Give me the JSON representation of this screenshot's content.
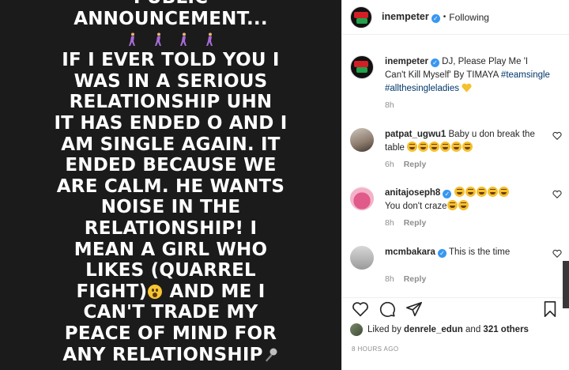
{
  "media": {
    "lines": [
      "PUBLIC",
      "ANNOUNCEMENT...",
      "IF I EVER TOLD YOU I",
      "WAS IN A SERIOUS",
      "RELATIONSHIP UHN",
      "IT HAS ENDED O AND I",
      "AM SINGLE AGAIN. IT",
      "ENDED BECAUSE WE",
      "ARE CALM. HE WANTS",
      "NOISE IN THE",
      "RELATIONSHIP! I",
      "MEAN A GIRL WHO",
      "LIKES (QUARREL",
      "FIGHT)",
      "AND ME I",
      "CAN'T TRADE MY",
      "PEACE OF MIND FOR",
      "ANY RELATIONSHIP"
    ]
  },
  "post": {
    "username": "inempeter",
    "separator": "•",
    "follow_status": "Following",
    "caption_text": "DJ, Please Play Me 'I Can't Kill Myself' By TIMAYA",
    "caption_tags": "#teamsingle #allthesingleladies",
    "caption_age": "8h"
  },
  "comments": [
    {
      "username": "patpat_ugwu1",
      "text": "Baby u don break the table",
      "age": "6h",
      "reply": "Reply"
    },
    {
      "username": "anitajoseph8",
      "text": "You don't craze",
      "age": "8h",
      "reply": "Reply"
    },
    {
      "username": "mcmbakara",
      "text": "This is the time",
      "age": "8h",
      "reply": "Reply"
    }
  ],
  "likes": {
    "prefix": "Liked by",
    "user": "denrele_edun",
    "middle": "and",
    "others": "321 others"
  },
  "timestamp": "8 HOURS AGO",
  "colors": {
    "verified": "#3897f0",
    "tag": "#00376b",
    "muted": "#8e8e8e"
  }
}
